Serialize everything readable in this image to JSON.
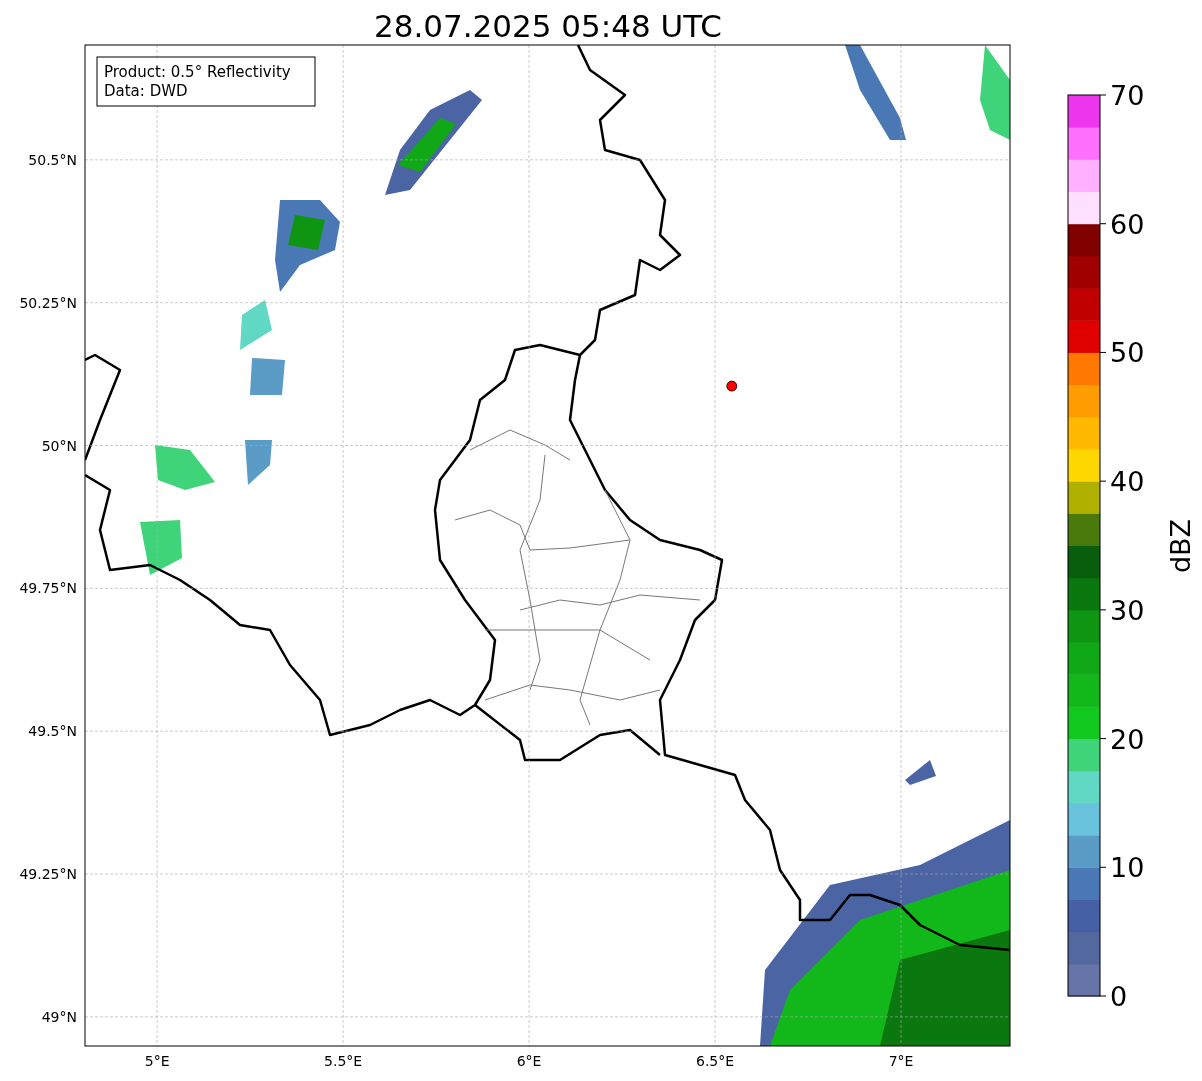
{
  "title": "28.07.2025 05:48 UTC",
  "legend": {
    "lines": [
      "Product: 0.5° Reflectivity",
      "Data: DWD"
    ]
  },
  "map": {
    "chart_data": {
      "type": "scatter",
      "grid": true,
      "xlim": [
        4.806,
        7.293
      ],
      "ylim": [
        48.949,
        50.701
      ],
      "xticks": [
        {
          "value": 5,
          "label": "5°E"
        },
        {
          "value": 5.5,
          "label": "5.5°E"
        },
        {
          "value": 6,
          "label": "6°E"
        },
        {
          "value": 6.5,
          "label": "6.5°E"
        },
        {
          "value": 7,
          "label": "7°E"
        }
      ],
      "yticks": [
        {
          "value": 49,
          "label": "49°N"
        },
        {
          "value": 49.25,
          "label": "49.25°N"
        },
        {
          "value": 49.5,
          "label": "49.5°N"
        },
        {
          "value": 49.75,
          "label": "49.75°N"
        },
        {
          "value": 50,
          "label": "50°N"
        },
        {
          "value": 50.25,
          "label": "50.25°N"
        },
        {
          "value": 50.5,
          "label": "50.5°N"
        }
      ],
      "x": [
        6.545
      ],
      "series": [
        {
          "color": "#ff0000",
          "values": [
            50.104
          ]
        }
      ]
    }
  },
  "colorbar": {
    "label": "dBZ",
    "ticks": [
      "70",
      "60",
      "50",
      "40",
      "30",
      "20",
      "10",
      "0"
    ],
    "segments": [
      {
        "color": "#6674a8"
      },
      {
        "color": "#5468a0"
      },
      {
        "color": "#4560a5"
      },
      {
        "color": "#4a78b5"
      },
      {
        "color": "#5a9cc5"
      },
      {
        "color": "#68c2dc"
      },
      {
        "color": "#60d8c4"
      },
      {
        "color": "#40d47a"
      },
      {
        "color": "#10c81e"
      },
      {
        "color": "#12b81a"
      },
      {
        "color": "#10a816"
      },
      {
        "color": "#0e9612"
      },
      {
        "color": "#0a780e"
      },
      {
        "color": "#085e0c"
      },
      {
        "color": "#4a7a0c"
      },
      {
        "color": "#b0b000"
      },
      {
        "color": "#ffd700"
      },
      {
        "color": "#ffba00"
      },
      {
        "color": "#ff9c00"
      },
      {
        "color": "#ff7800"
      },
      {
        "color": "#e00000"
      },
      {
        "color": "#c00000"
      },
      {
        "color": "#a00000"
      },
      {
        "color": "#800000"
      },
      {
        "color": "#ffe0ff"
      },
      {
        "color": "#ffb0ff"
      },
      {
        "color": "#ff70ff"
      },
      {
        "color": "#ee36ee"
      }
    ]
  }
}
